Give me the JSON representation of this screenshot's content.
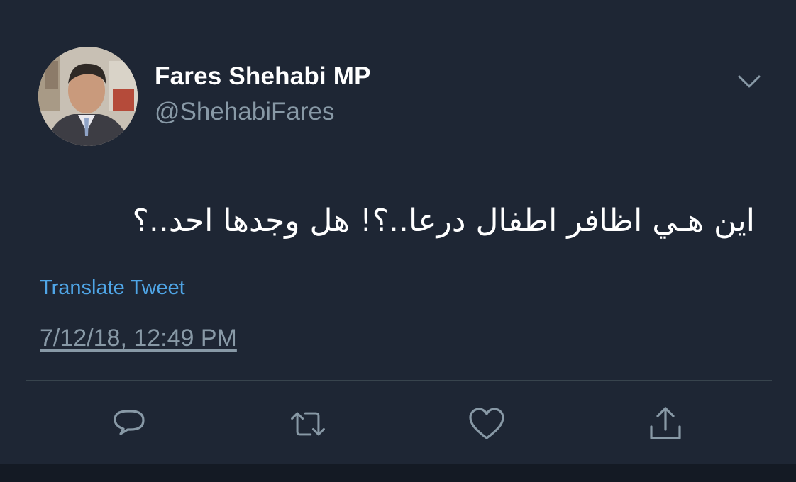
{
  "tweet": {
    "display_name": "Fares Shehabi MP",
    "handle": "@ShehabiFares",
    "text": "اين هـي اظافر اطفال درعا..؟! هل وجدها احد..؟",
    "translate_label": "Translate Tweet",
    "timestamp": "7/12/18, 12:49 PM",
    "avatar_icon": "profile-photo",
    "menu_icon": "chevron-down-icon"
  },
  "actions": [
    {
      "name": "reply",
      "icon": "reply-icon"
    },
    {
      "name": "retweet",
      "icon": "retweet-icon"
    },
    {
      "name": "like",
      "icon": "heart-icon"
    },
    {
      "name": "share",
      "icon": "share-icon"
    }
  ],
  "colors": {
    "background": "#1e2634",
    "name": "#ffffff",
    "secondary": "#8899a6",
    "link": "#4fa5e6",
    "divider": "#38444d"
  }
}
